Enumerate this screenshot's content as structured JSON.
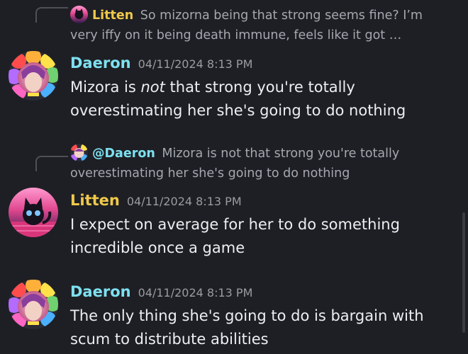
{
  "colors": {
    "daeron": "#7de0f0",
    "litten": "#f0c94a",
    "background": "#1e1f24"
  },
  "messages": [
    {
      "reply": {
        "author": "Litten",
        "line1": "So mizorna being that strong seems fine? I’m",
        "line2": "very iffy on it being death immune, feels like it got …"
      },
      "author": "Daeron",
      "timestamp": "04/11/2024 8:13 PM",
      "text_pre": "Mizora is ",
      "text_em": "not",
      "text_post": " that strong you're totally overestimating her she's going to do nothing"
    },
    {
      "reply": {
        "author": "@Daeron",
        "line1": "Mizora is not that strong you're totally",
        "line2": "overestimating her she's going to do nothing"
      },
      "author": "Litten",
      "timestamp": "04/11/2024 8:13 PM",
      "text": "I expect on average for her to do something incredible once a game"
    },
    {
      "author": "Daeron",
      "timestamp": "04/11/2024 8:13 PM",
      "text": "The only thing she's going to do is bargain with scum to distribute abilities"
    }
  ]
}
